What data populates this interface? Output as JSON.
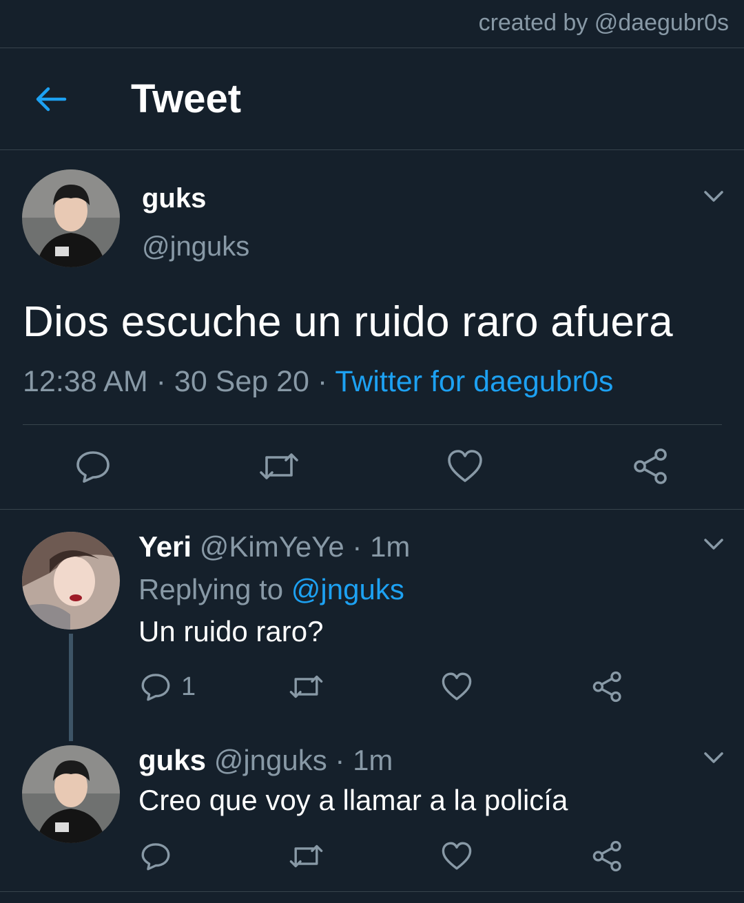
{
  "credit": "created by @daegubr0s",
  "header": {
    "title": "Tweet",
    "back_icon": "arrow-left-icon"
  },
  "main_tweet": {
    "name": "guks",
    "handle": "@jnguks",
    "text": "Dios escuche un ruido raro afuera",
    "time": "12:38 AM",
    "date": "30 Sep 20",
    "source": "Twitter for daegubr0s",
    "sep": " · "
  },
  "replies": [
    {
      "name": "Yeri",
      "handle": "@KimYeYe",
      "time": "1m",
      "replying_prefix": "Replying to ",
      "replying_to": "@jnguks",
      "text": "Un ruido raro?",
      "reply_count": "1"
    },
    {
      "name": "guks",
      "handle": "@jnguks",
      "time": "1m",
      "text": "Creo que voy a llamar a la policía"
    }
  ],
  "colors": {
    "background": "#15202b",
    "accent": "#1da1f2",
    "muted": "#8899a6",
    "divider": "#38444d"
  }
}
